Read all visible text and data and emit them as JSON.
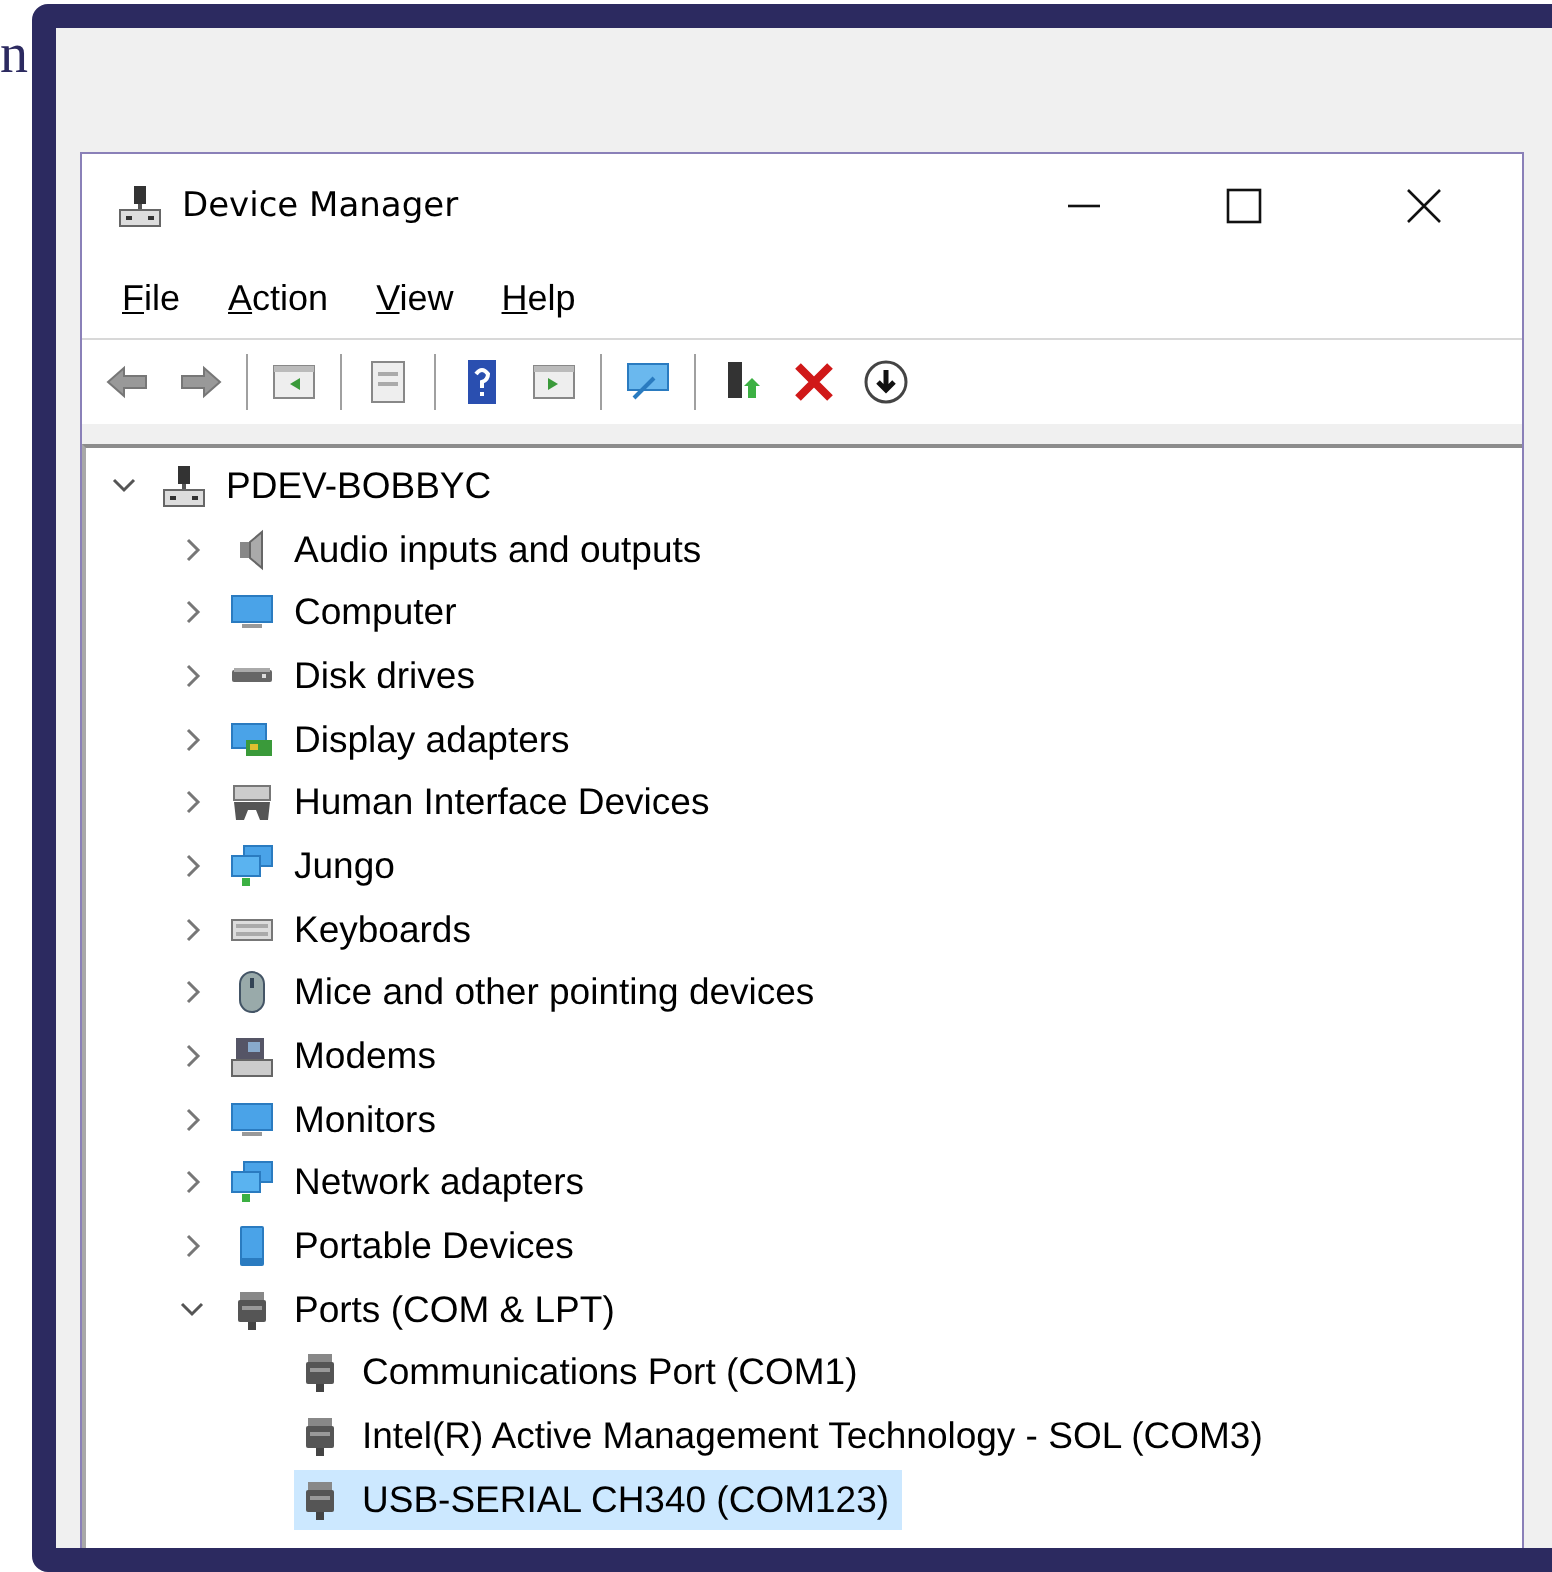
{
  "page_heading_fragment": "n",
  "window": {
    "title": "Device Manager"
  },
  "menu": [
    {
      "label": "File"
    },
    {
      "label": "Action"
    },
    {
      "label": "View"
    },
    {
      "label": "Help"
    }
  ],
  "tree": [
    {
      "label": "PDEV-BOBBYC",
      "kind": "computer",
      "expanded": true,
      "selected": false,
      "children": [
        {
          "label": "Audio inputs and outputs",
          "kind": "speaker",
          "expanded": false,
          "selected": false
        },
        {
          "label": "Computer",
          "kind": "monitor",
          "expanded": false,
          "selected": false
        },
        {
          "label": "Disk drives",
          "kind": "disk",
          "expanded": false,
          "selected": false
        },
        {
          "label": "Display adapters",
          "kind": "display",
          "expanded": false,
          "selected": false
        },
        {
          "label": "Human Interface Devices",
          "kind": "hid",
          "expanded": false,
          "selected": false
        },
        {
          "label": "Jungo",
          "kind": "network",
          "expanded": false,
          "selected": false
        },
        {
          "label": "Keyboards",
          "kind": "keyboard",
          "expanded": false,
          "selected": false
        },
        {
          "label": "Mice and other pointing devices",
          "kind": "mouse",
          "expanded": false,
          "selected": false
        },
        {
          "label": "Modems",
          "kind": "modem",
          "expanded": false,
          "selected": false
        },
        {
          "label": "Monitors",
          "kind": "monitor",
          "expanded": false,
          "selected": false
        },
        {
          "label": "Network adapters",
          "kind": "network",
          "expanded": false,
          "selected": false
        },
        {
          "label": "Portable Devices",
          "kind": "portable",
          "expanded": false,
          "selected": false
        },
        {
          "label": "Ports (COM & LPT)",
          "kind": "port",
          "expanded": true,
          "selected": false,
          "children": [
            {
              "label": "Communications Port (COM1)",
              "kind": "port",
              "selected": false
            },
            {
              "label": "Intel(R) Active Management Technology - SOL (COM3)",
              "kind": "port",
              "selected": false
            },
            {
              "label": "USB-SERIAL CH340 (COM123)",
              "kind": "port",
              "selected": true
            }
          ]
        }
      ]
    }
  ]
}
